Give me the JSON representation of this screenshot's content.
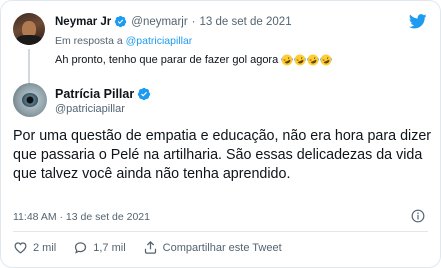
{
  "parent_tweet": {
    "author_name": "Neymar Jr",
    "handle": "@neymarjr",
    "separator": "·",
    "date": "13 de set de 2021",
    "reply_prefix": "Em resposta a",
    "reply_mention": "@patriciapillar",
    "text": "Ah pronto, tenho que parar de fazer gol agora",
    "emojis": [
      "rofl-emoji",
      "rofl-emoji",
      "rofl-emoji",
      "rofl-emoji"
    ]
  },
  "main_tweet": {
    "author_name": "Patrícia Pillar",
    "handle": "@patriciapillar",
    "text": "Por uma questão de empatia e educação, não era hora para dizer que passaria o Pelé na artilharia. São essas delicadezas da vida que talvez você ainda não tenha aprendido.",
    "timestamp": "11:48 AM · 13 de set de 2021"
  },
  "actions": {
    "likes": "2 mil",
    "replies": "1,7 mil",
    "share_label": "Compartilhar este Tweet"
  },
  "icons": {
    "brand": "twitter-bird-icon",
    "verified": "verified-badge-icon",
    "info": "info-icon",
    "like": "heart-icon",
    "reply": "speech-bubble-icon",
    "share": "share-icon"
  },
  "colors": {
    "brand_blue": "#1d9bf0",
    "text_primary": "#0f1419",
    "text_secondary": "#536471",
    "border": "#e1e8ed"
  }
}
